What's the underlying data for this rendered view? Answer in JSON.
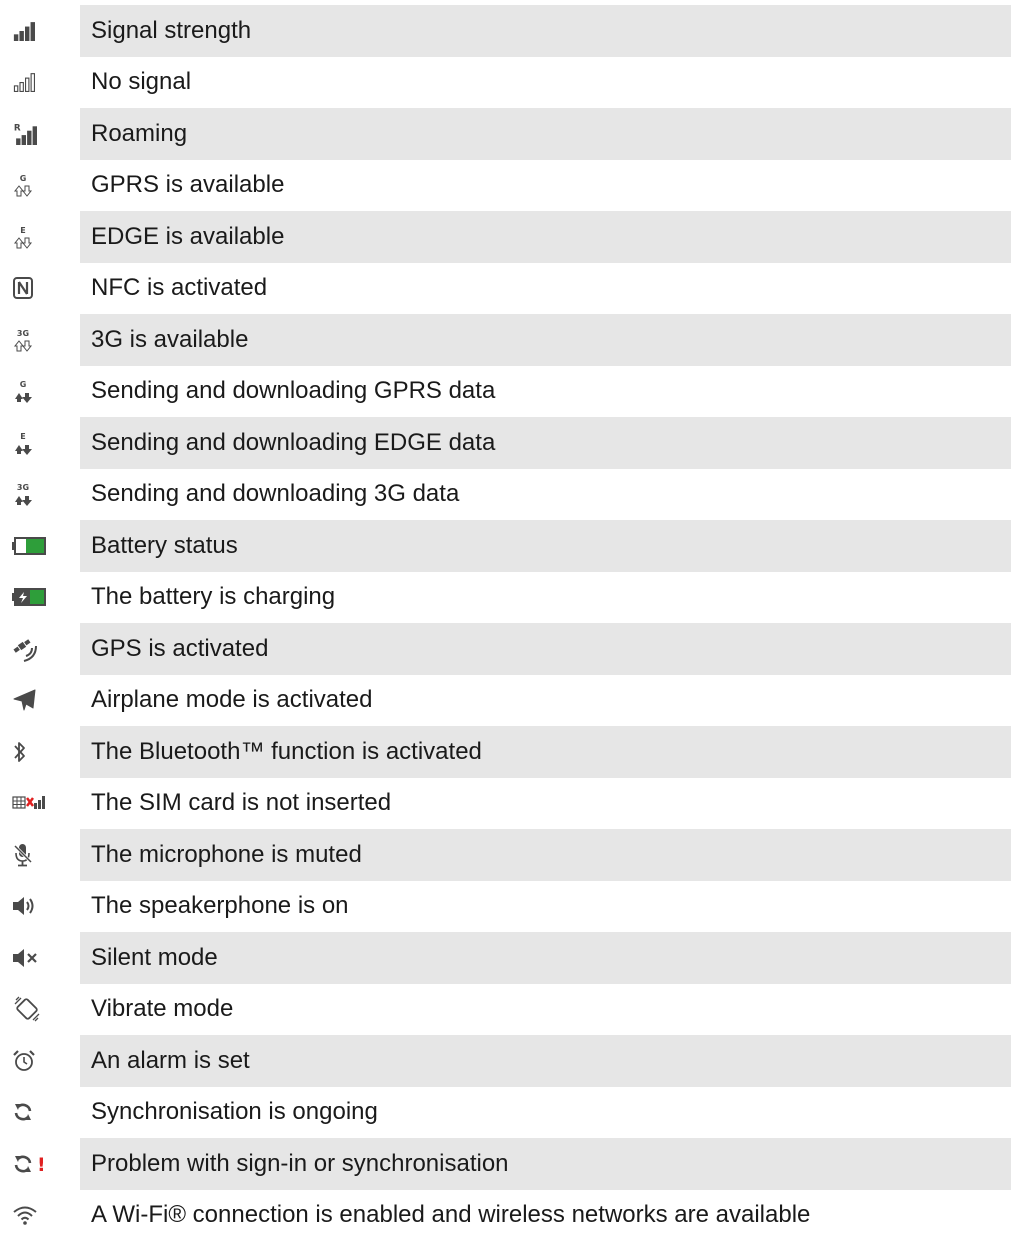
{
  "rows": [
    {
      "icon": "signal-strength-icon",
      "label": "Signal strength"
    },
    {
      "icon": "no-signal-icon",
      "label": "No signal"
    },
    {
      "icon": "roaming-icon",
      "label": "Roaming"
    },
    {
      "icon": "gprs-icon",
      "label": "GPRS is available"
    },
    {
      "icon": "edge-icon",
      "label": "EDGE is available"
    },
    {
      "icon": "nfc-icon",
      "label": "NFC is activated"
    },
    {
      "icon": "3g-icon",
      "label": "3G is available"
    },
    {
      "icon": "gprs-data-icon",
      "label": "Sending and downloading GPRS data"
    },
    {
      "icon": "edge-data-icon",
      "label": "Sending and downloading EDGE data"
    },
    {
      "icon": "3g-data-icon",
      "label": "Sending and downloading 3G data"
    },
    {
      "icon": "battery-icon",
      "label": "Battery status"
    },
    {
      "icon": "battery-charging-icon",
      "label": "The battery is charging"
    },
    {
      "icon": "gps-icon",
      "label": "GPS is activated"
    },
    {
      "icon": "airplane-icon",
      "label": "Airplane mode is activated"
    },
    {
      "icon": "bluetooth-icon",
      "label": "The Bluetooth™ function is activated"
    },
    {
      "icon": "no-sim-icon",
      "label": "The SIM card is not inserted"
    },
    {
      "icon": "mic-muted-icon",
      "label": "The microphone is muted"
    },
    {
      "icon": "speakerphone-icon",
      "label": "The speakerphone is on"
    },
    {
      "icon": "silent-icon",
      "label": "Silent mode"
    },
    {
      "icon": "vibrate-icon",
      "label": "Vibrate mode"
    },
    {
      "icon": "alarm-icon",
      "label": "An alarm is set"
    },
    {
      "icon": "sync-icon",
      "label": "Synchronisation is ongoing"
    },
    {
      "icon": "sync-problem-icon",
      "label": "Problem with sign-in or synchronisation"
    },
    {
      "icon": "wifi-icon",
      "label": "A Wi-Fi® connection is enabled and wireless networks are available"
    }
  ],
  "icon_glyphs": {
    "gprs": "G",
    "edge": "E",
    "3g": "3G",
    "roaming": "R",
    "problem": "!"
  },
  "colors": {
    "shade": "#e6e6e6",
    "icon": "#4a4a4a",
    "battery_green": "#2e9e3a",
    "alert_red": "#e02020"
  }
}
